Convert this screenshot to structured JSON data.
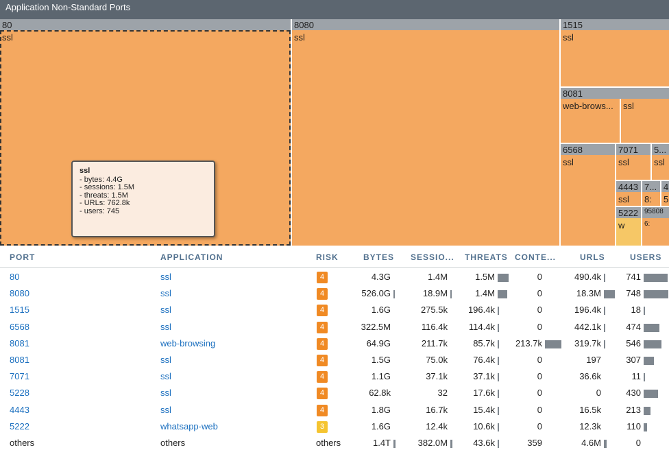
{
  "title": "Application Non-Standard Ports",
  "treemap": {
    "headers": [
      "80",
      "8080",
      "1515",
      "8081",
      "6568",
      "7071",
      "5...",
      "4443",
      "7...",
      "4",
      "5222",
      "95808"
    ],
    "cells": [
      "ssl",
      "ssl",
      "ssl",
      "web-brows...",
      "ssl",
      "ssl",
      "ssl",
      "ssl",
      "ssl",
      "8:",
      "5:",
      "w",
      "6:"
    ]
  },
  "tooltip": {
    "title": "ssl",
    "lines": [
      "- bytes: 4.4G",
      "- sessions: 1.5M",
      "- threats: 1.5M",
      "- URLs: 762.8k",
      "- users: 745"
    ]
  },
  "table": {
    "columns": [
      "PORT",
      "APPLICATION",
      "RISK",
      "BYTES",
      "SESSIO...",
      "THREATS",
      "CONTE...",
      "URLS",
      "USERS"
    ],
    "rows": [
      {
        "port": "80",
        "application": "ssl",
        "risk": "4",
        "bytes": "4.3G",
        "sessions": "1.4M",
        "threats": "1.5M",
        "content": "0",
        "urls": "490.4k",
        "users": "741"
      },
      {
        "port": "8080",
        "application": "ssl",
        "risk": "4",
        "bytes": "526.0G",
        "sessions": "18.9M",
        "threats": "1.4M",
        "content": "0",
        "urls": "18.3M",
        "users": "748"
      },
      {
        "port": "1515",
        "application": "ssl",
        "risk": "4",
        "bytes": "1.6G",
        "sessions": "275.5k",
        "threats": "196.4k",
        "content": "0",
        "urls": "196.4k",
        "users": "18"
      },
      {
        "port": "6568",
        "application": "ssl",
        "risk": "4",
        "bytes": "322.5M",
        "sessions": "116.4k",
        "threats": "114.4k",
        "content": "0",
        "urls": "442.1k",
        "users": "474"
      },
      {
        "port": "8081",
        "application": "web-browsing",
        "risk": "4",
        "bytes": "64.9G",
        "sessions": "211.7k",
        "threats": "85.7k",
        "content": "213.7k",
        "urls": "319.7k",
        "users": "546"
      },
      {
        "port": "8081",
        "application": "ssl",
        "risk": "4",
        "bytes": "1.5G",
        "sessions": "75.0k",
        "threats": "76.4k",
        "content": "0",
        "urls": "197",
        "users": "307"
      },
      {
        "port": "7071",
        "application": "ssl",
        "risk": "4",
        "bytes": "1.1G",
        "sessions": "37.1k",
        "threats": "37.1k",
        "content": "0",
        "urls": "36.6k",
        "users": "11"
      },
      {
        "port": "5228",
        "application": "ssl",
        "risk": "4",
        "bytes": "62.8k",
        "sessions": "32",
        "threats": "17.6k",
        "content": "0",
        "urls": "0",
        "users": "430"
      },
      {
        "port": "4443",
        "application": "ssl",
        "risk": "4",
        "bytes": "1.8G",
        "sessions": "16.7k",
        "threats": "15.4k",
        "content": "0",
        "urls": "16.5k",
        "users": "213"
      },
      {
        "port": "5222",
        "application": "whatsapp-web",
        "risk": "3",
        "bytes": "1.6G",
        "sessions": "12.4k",
        "threats": "10.6k",
        "content": "0",
        "urls": "12.3k",
        "users": "110"
      },
      {
        "port": "others",
        "application": "others",
        "risk": "others",
        "bytes": "1.4T",
        "sessions": "382.0M",
        "threats": "43.6k",
        "content": "359",
        "urls": "4.6M",
        "users": "0"
      }
    ],
    "bar_fractions": {
      "bytes": [
        0,
        0.2,
        0,
        0,
        0,
        0,
        0,
        0,
        0,
        0,
        0.55
      ],
      "sessions": [
        0,
        0.2,
        0,
        0,
        0,
        0,
        0,
        0,
        0,
        0,
        0.55
      ],
      "threats": [
        0.98,
        0.9,
        0.12,
        0.1,
        0.08,
        0.06,
        0.04,
        0.02,
        0.02,
        0.02,
        0.04
      ],
      "content": [
        0,
        0,
        0,
        0,
        1,
        0,
        0,
        0,
        0,
        0,
        0
      ],
      "urls": [
        0.03,
        1,
        0.02,
        0.03,
        0.02,
        0,
        0,
        0,
        0,
        0,
        0.25
      ],
      "users": [
        0.98,
        1,
        0.05,
        0.63,
        0.73,
        0.41,
        0.04,
        0.57,
        0.29,
        0.15,
        0
      ]
    }
  },
  "colors": {
    "title_bar": "#5c6670",
    "treemap_header": "#9da3a9",
    "treemap_cell": "#f4a860",
    "risk_4": "#f08a24",
    "risk_3": "#f5c430",
    "link": "#1a6fbf",
    "bar": "#7e868e"
  }
}
